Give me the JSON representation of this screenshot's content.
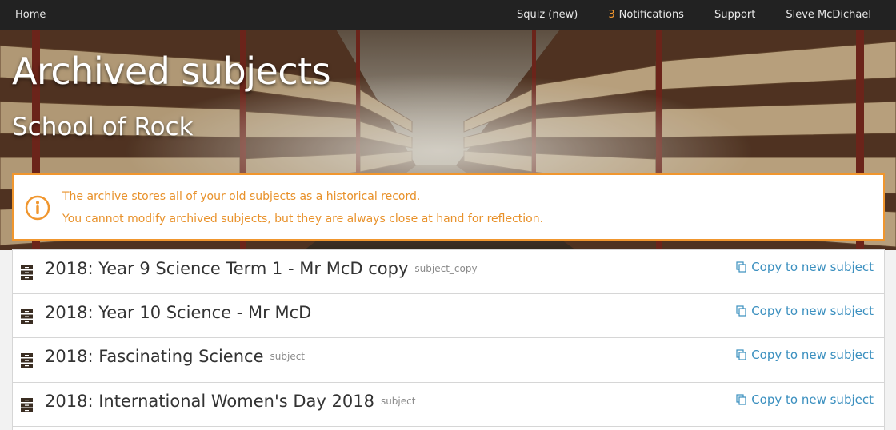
{
  "nav": {
    "home": "Home",
    "quiz": "Squiz (new)",
    "notifications_count": "3",
    "notifications_label": "Notifications",
    "support": "Support",
    "user": "Sleve McDichael"
  },
  "hero": {
    "title": "Archived subjects",
    "subtitle": "School of Rock"
  },
  "info": {
    "line1": "The archive stores all of your old subjects as a historical record.",
    "line2": "You cannot modify archived subjects, but they are always close at hand for reflection.",
    "icon": "info-circle-icon",
    "color": "#f0962e"
  },
  "subjects": [
    {
      "name": "2018: Year 9 Science Term 1 - Mr McD copy",
      "tag": "subject_copy",
      "action": "Copy to new subject"
    },
    {
      "name": "2018: Year 10 Science - Mr McD",
      "tag": "",
      "action": "Copy to new subject"
    },
    {
      "name": "2018: Fascinating Science",
      "tag": "subject",
      "action": "Copy to new subject"
    },
    {
      "name": "2018: International Women's Day 2018",
      "tag": "subject",
      "action": "Copy to new subject"
    }
  ],
  "colors": {
    "nav_bg": "#222222",
    "accent": "#f0962e",
    "link": "#3a8fbf"
  }
}
